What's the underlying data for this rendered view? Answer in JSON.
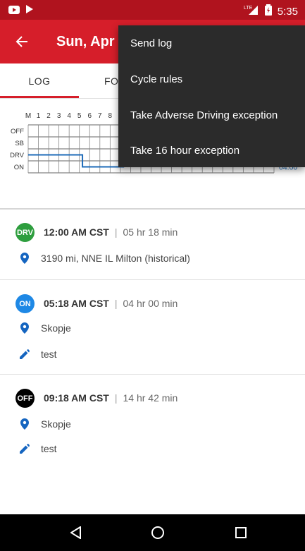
{
  "status_bar": {
    "time": "5:35",
    "network": "LTE"
  },
  "app_bar": {
    "title": "Sun, Apr "
  },
  "tabs": [
    {
      "label": "LOG",
      "selected": true
    },
    {
      "label": "FO",
      "selected": false
    }
  ],
  "graph": {
    "hours_labels": [
      "M",
      "1",
      "2",
      "3",
      "4",
      "5",
      "6",
      "7",
      "8"
    ],
    "rows": [
      "OFF",
      "SB",
      "DRV",
      "ON"
    ],
    "total_on": "04:00"
  },
  "entries": [
    {
      "badge": "DRV",
      "badge_color": "#2e9e3e",
      "time": "12:00 AM CST",
      "duration": "05 hr  18 min",
      "location": "3190 mi, NNE IL Milton (historical)",
      "note": ""
    },
    {
      "badge": "ON",
      "badge_color": "#1e88e5",
      "time": "05:18 AM CST",
      "duration": "04 hr  00 min",
      "location": "Skopje",
      "note": "test"
    },
    {
      "badge": "OFF",
      "badge_color": "#000000",
      "time": "09:18 AM CST",
      "duration": "14 hr  42 min",
      "location": "Skopje",
      "note": "test"
    }
  ],
  "separator": "|",
  "menu": {
    "items": [
      "Send log",
      "Cycle rules",
      "Take Adverse Driving exception",
      "Take 16 hour exception"
    ]
  },
  "colors": {
    "accent": "#d61e2a",
    "status_bar": "#b0131e",
    "graph_line": "#1e6bb8",
    "icon_blue": "#1565c0"
  }
}
